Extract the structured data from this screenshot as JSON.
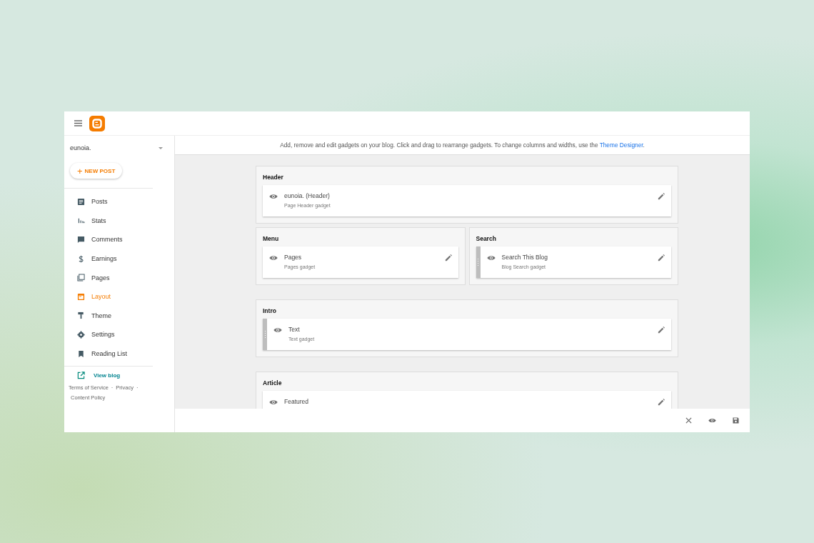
{
  "sidebar": {
    "blog_name": "eunoia.",
    "new_post": {
      "icon": "+",
      "label": "NEW POST"
    },
    "items": [
      {
        "label": "Posts",
        "kind": "posts",
        "selected": false
      },
      {
        "label": "Stats",
        "kind": "stats",
        "selected": false
      },
      {
        "label": "Comments",
        "kind": "comments",
        "selected": false
      },
      {
        "label": "Earnings",
        "kind": "earnings",
        "selected": false
      },
      {
        "label": "Pages",
        "kind": "pages",
        "selected": false
      },
      {
        "label": "Layout",
        "kind": "layout",
        "selected": true
      },
      {
        "label": "Theme",
        "kind": "theme",
        "selected": false
      },
      {
        "label": "Settings",
        "kind": "settings",
        "selected": false
      },
      {
        "label": "Reading List",
        "kind": "reading",
        "selected": false
      }
    ],
    "view_blog": "View blog",
    "footer_links": [
      "Terms of Service",
      "Privacy",
      "Content Policy"
    ],
    "separator": "·"
  },
  "info": {
    "text": "Add, remove and edit gadgets on your blog. Click and drag to rearrange gadgets. To change columns and widths, use the",
    "link": "Theme Designer",
    "end": "."
  },
  "groups": [
    {
      "rows": [
        {
          "sections": [
            {
              "title": "Header",
              "gadgets": [
                {
                  "title": "eunoia. (Header)",
                  "subtitle": "Page Header gadget",
                  "handle": false
                }
              ]
            }
          ]
        },
        {
          "sections": [
            {
              "title": "Menu",
              "gadgets": [
                {
                  "title": "Pages",
                  "subtitle": "Pages gadget",
                  "handle": false
                }
              ]
            },
            {
              "title": "Search",
              "gadgets": [
                {
                  "title": "Search This Blog",
                  "subtitle": "Blog Search gadget",
                  "handle": true
                }
              ]
            }
          ]
        }
      ]
    },
    {
      "rows": [
        {
          "sections": [
            {
              "title": "Intro",
              "gadgets": [
                {
                  "title": "Text",
                  "subtitle": "Text gadget",
                  "handle": true
                }
              ]
            }
          ]
        }
      ]
    },
    {
      "rows": [
        {
          "sections": [
            {
              "title": "Article",
              "gadgets": [
                {
                  "title": "Featured",
                  "handle": false
                }
              ]
            }
          ]
        }
      ]
    }
  ]
}
